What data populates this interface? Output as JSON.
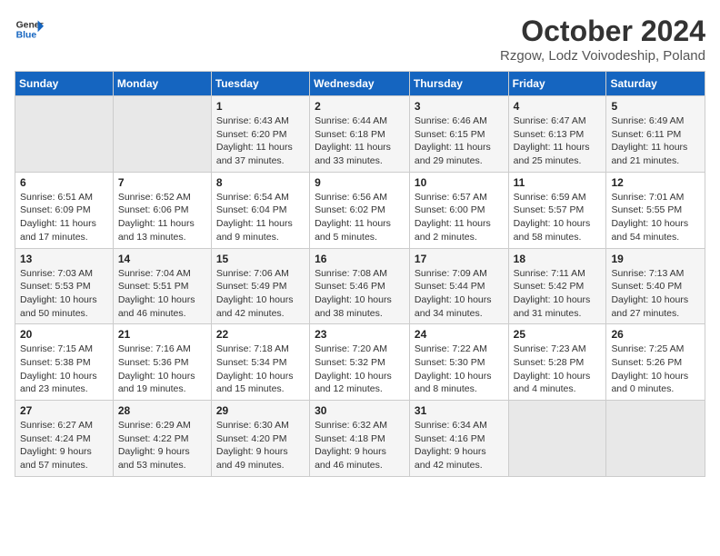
{
  "header": {
    "logo_line1": "General",
    "logo_line2": "Blue",
    "title": "October 2024",
    "subtitle": "Rzgow, Lodz Voivodeship, Poland"
  },
  "weekdays": [
    "Sunday",
    "Monday",
    "Tuesday",
    "Wednesday",
    "Thursday",
    "Friday",
    "Saturday"
  ],
  "weeks": [
    [
      {
        "day": "",
        "sunrise": "",
        "sunset": "",
        "daylight": ""
      },
      {
        "day": "",
        "sunrise": "",
        "sunset": "",
        "daylight": ""
      },
      {
        "day": "1",
        "sunrise": "Sunrise: 6:43 AM",
        "sunset": "Sunset: 6:20 PM",
        "daylight": "Daylight: 11 hours and 37 minutes."
      },
      {
        "day": "2",
        "sunrise": "Sunrise: 6:44 AM",
        "sunset": "Sunset: 6:18 PM",
        "daylight": "Daylight: 11 hours and 33 minutes."
      },
      {
        "day": "3",
        "sunrise": "Sunrise: 6:46 AM",
        "sunset": "Sunset: 6:15 PM",
        "daylight": "Daylight: 11 hours and 29 minutes."
      },
      {
        "day": "4",
        "sunrise": "Sunrise: 6:47 AM",
        "sunset": "Sunset: 6:13 PM",
        "daylight": "Daylight: 11 hours and 25 minutes."
      },
      {
        "day": "5",
        "sunrise": "Sunrise: 6:49 AM",
        "sunset": "Sunset: 6:11 PM",
        "daylight": "Daylight: 11 hours and 21 minutes."
      }
    ],
    [
      {
        "day": "6",
        "sunrise": "Sunrise: 6:51 AM",
        "sunset": "Sunset: 6:09 PM",
        "daylight": "Daylight: 11 hours and 17 minutes."
      },
      {
        "day": "7",
        "sunrise": "Sunrise: 6:52 AM",
        "sunset": "Sunset: 6:06 PM",
        "daylight": "Daylight: 11 hours and 13 minutes."
      },
      {
        "day": "8",
        "sunrise": "Sunrise: 6:54 AM",
        "sunset": "Sunset: 6:04 PM",
        "daylight": "Daylight: 11 hours and 9 minutes."
      },
      {
        "day": "9",
        "sunrise": "Sunrise: 6:56 AM",
        "sunset": "Sunset: 6:02 PM",
        "daylight": "Daylight: 11 hours and 5 minutes."
      },
      {
        "day": "10",
        "sunrise": "Sunrise: 6:57 AM",
        "sunset": "Sunset: 6:00 PM",
        "daylight": "Daylight: 11 hours and 2 minutes."
      },
      {
        "day": "11",
        "sunrise": "Sunrise: 6:59 AM",
        "sunset": "Sunset: 5:57 PM",
        "daylight": "Daylight: 10 hours and 58 minutes."
      },
      {
        "day": "12",
        "sunrise": "Sunrise: 7:01 AM",
        "sunset": "Sunset: 5:55 PM",
        "daylight": "Daylight: 10 hours and 54 minutes."
      }
    ],
    [
      {
        "day": "13",
        "sunrise": "Sunrise: 7:03 AM",
        "sunset": "Sunset: 5:53 PM",
        "daylight": "Daylight: 10 hours and 50 minutes."
      },
      {
        "day": "14",
        "sunrise": "Sunrise: 7:04 AM",
        "sunset": "Sunset: 5:51 PM",
        "daylight": "Daylight: 10 hours and 46 minutes."
      },
      {
        "day": "15",
        "sunrise": "Sunrise: 7:06 AM",
        "sunset": "Sunset: 5:49 PM",
        "daylight": "Daylight: 10 hours and 42 minutes."
      },
      {
        "day": "16",
        "sunrise": "Sunrise: 7:08 AM",
        "sunset": "Sunset: 5:46 PM",
        "daylight": "Daylight: 10 hours and 38 minutes."
      },
      {
        "day": "17",
        "sunrise": "Sunrise: 7:09 AM",
        "sunset": "Sunset: 5:44 PM",
        "daylight": "Daylight: 10 hours and 34 minutes."
      },
      {
        "day": "18",
        "sunrise": "Sunrise: 7:11 AM",
        "sunset": "Sunset: 5:42 PM",
        "daylight": "Daylight: 10 hours and 31 minutes."
      },
      {
        "day": "19",
        "sunrise": "Sunrise: 7:13 AM",
        "sunset": "Sunset: 5:40 PM",
        "daylight": "Daylight: 10 hours and 27 minutes."
      }
    ],
    [
      {
        "day": "20",
        "sunrise": "Sunrise: 7:15 AM",
        "sunset": "Sunset: 5:38 PM",
        "daylight": "Daylight: 10 hours and 23 minutes."
      },
      {
        "day": "21",
        "sunrise": "Sunrise: 7:16 AM",
        "sunset": "Sunset: 5:36 PM",
        "daylight": "Daylight: 10 hours and 19 minutes."
      },
      {
        "day": "22",
        "sunrise": "Sunrise: 7:18 AM",
        "sunset": "Sunset: 5:34 PM",
        "daylight": "Daylight: 10 hours and 15 minutes."
      },
      {
        "day": "23",
        "sunrise": "Sunrise: 7:20 AM",
        "sunset": "Sunset: 5:32 PM",
        "daylight": "Daylight: 10 hours and 12 minutes."
      },
      {
        "day": "24",
        "sunrise": "Sunrise: 7:22 AM",
        "sunset": "Sunset: 5:30 PM",
        "daylight": "Daylight: 10 hours and 8 minutes."
      },
      {
        "day": "25",
        "sunrise": "Sunrise: 7:23 AM",
        "sunset": "Sunset: 5:28 PM",
        "daylight": "Daylight: 10 hours and 4 minutes."
      },
      {
        "day": "26",
        "sunrise": "Sunrise: 7:25 AM",
        "sunset": "Sunset: 5:26 PM",
        "daylight": "Daylight: 10 hours and 0 minutes."
      }
    ],
    [
      {
        "day": "27",
        "sunrise": "Sunrise: 6:27 AM",
        "sunset": "Sunset: 4:24 PM",
        "daylight": "Daylight: 9 hours and 57 minutes."
      },
      {
        "day": "28",
        "sunrise": "Sunrise: 6:29 AM",
        "sunset": "Sunset: 4:22 PM",
        "daylight": "Daylight: 9 hours and 53 minutes."
      },
      {
        "day": "29",
        "sunrise": "Sunrise: 6:30 AM",
        "sunset": "Sunset: 4:20 PM",
        "daylight": "Daylight: 9 hours and 49 minutes."
      },
      {
        "day": "30",
        "sunrise": "Sunrise: 6:32 AM",
        "sunset": "Sunset: 4:18 PM",
        "daylight": "Daylight: 9 hours and 46 minutes."
      },
      {
        "day": "31",
        "sunrise": "Sunrise: 6:34 AM",
        "sunset": "Sunset: 4:16 PM",
        "daylight": "Daylight: 9 hours and 42 minutes."
      },
      {
        "day": "",
        "sunrise": "",
        "sunset": "",
        "daylight": ""
      },
      {
        "day": "",
        "sunrise": "",
        "sunset": "",
        "daylight": ""
      }
    ]
  ]
}
